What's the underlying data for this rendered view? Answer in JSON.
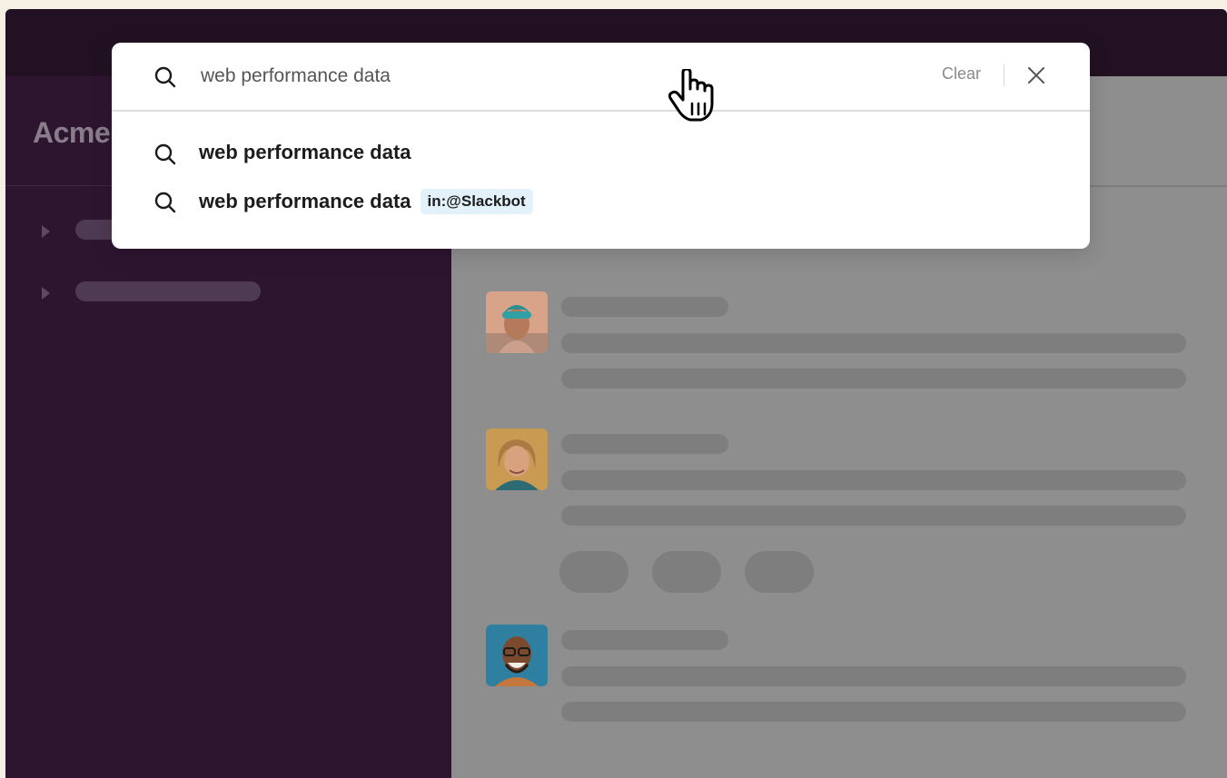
{
  "workspace": {
    "name": "Acme"
  },
  "search": {
    "query": "web performance data",
    "clear_label": "Clear",
    "suggestions": [
      {
        "text": "web performance data",
        "badge": ""
      },
      {
        "text": "web performance data",
        "badge": "in:@Slackbot"
      }
    ]
  },
  "icons": {
    "search": "search-icon",
    "close": "close-icon",
    "cursor": "hand-pointer-cursor-icon",
    "caret": "caret-right-icon"
  },
  "colors": {
    "sidebar": "#2d1530",
    "topbar": "#221122",
    "badge_bg": "#e3f1fb",
    "page_bg": "#f5efe4"
  }
}
